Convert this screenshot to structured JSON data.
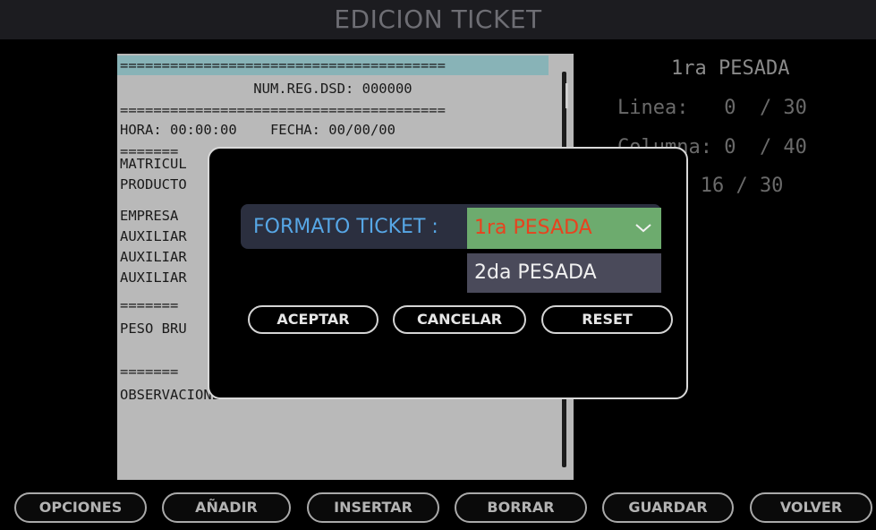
{
  "window": {
    "title": "EDICION TICKET"
  },
  "ticket": {
    "lines": [
      "=======================================",
      "                NUM.REG.DSD: 000000",
      "=======================================",
      "HORA: 00:00:00    FECHA: 00/00/00",
      "=======",
      "MATRICUL",
      "PRODUCTO",
      "EMPRESA",
      "AUXILIAR",
      "AUXILIAR",
      "AUXILIAR",
      "=======",
      "PESO BRU",
      "=======",
      "OBSERVACIONES"
    ]
  },
  "info": {
    "title": "1ra PESADA",
    "linea": "Linea:   0  / 30",
    "columna": "Columna: 0  / 40",
    "other": "  :    16 / 30"
  },
  "dialog": {
    "label": "FORMATO TICKET :",
    "selected": "1ra PESADA",
    "option": "2da PESADA",
    "buttons": {
      "accept": "ACEPTAR",
      "cancel": "CANCELAR",
      "reset": "RESET"
    }
  },
  "toolbar": {
    "opciones": "OPCIONES",
    "anadir": "AÑADIR",
    "insertar": "INSERTAR",
    "borrar": "BORRAR",
    "guardar": "GUARDAR",
    "volver": "VOLVER"
  },
  "colors": {
    "selected_bg": "#6dab6e",
    "selected_text": "#e8421e",
    "label_text": "#57a7e6",
    "ticket_bg": "#b9b9b9"
  }
}
